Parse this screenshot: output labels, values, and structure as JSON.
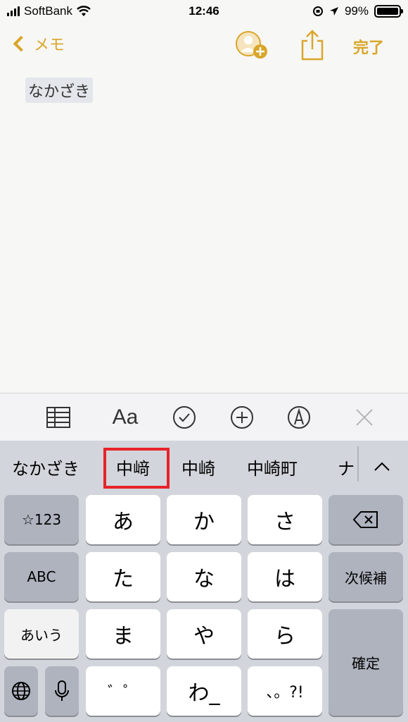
{
  "status_bar": {
    "carrier": "SoftBank",
    "time": "12:46",
    "battery_percent": "99%",
    "battery_level": 0.99
  },
  "nav": {
    "back_label": "メモ",
    "done_label": "完了"
  },
  "note": {
    "text": "なかざき"
  },
  "toolbar": {
    "format_label": "Aa",
    "icons": [
      "table-icon",
      "format-icon",
      "checklist-icon",
      "add-icon",
      "markup-icon",
      "close-icon"
    ]
  },
  "candidates": {
    "items": [
      "なかざき",
      "中﨑",
      "中崎",
      "中崎町",
      "ナ"
    ],
    "selected_index": 1
  },
  "keyboard": {
    "left": [
      "☆123",
      "ABC",
      "あいう"
    ],
    "center": [
      "あ",
      "か",
      "さ",
      "た",
      "な",
      "は",
      "ま",
      "や",
      "ら",
      "゛゜",
      "わ_",
      "、。?!"
    ],
    "right": [
      "次候補",
      "確定"
    ]
  },
  "colors": {
    "accent": "#d9a62a",
    "highlight": "#e8232a",
    "keyboard_bg": "#d2d5db"
  }
}
